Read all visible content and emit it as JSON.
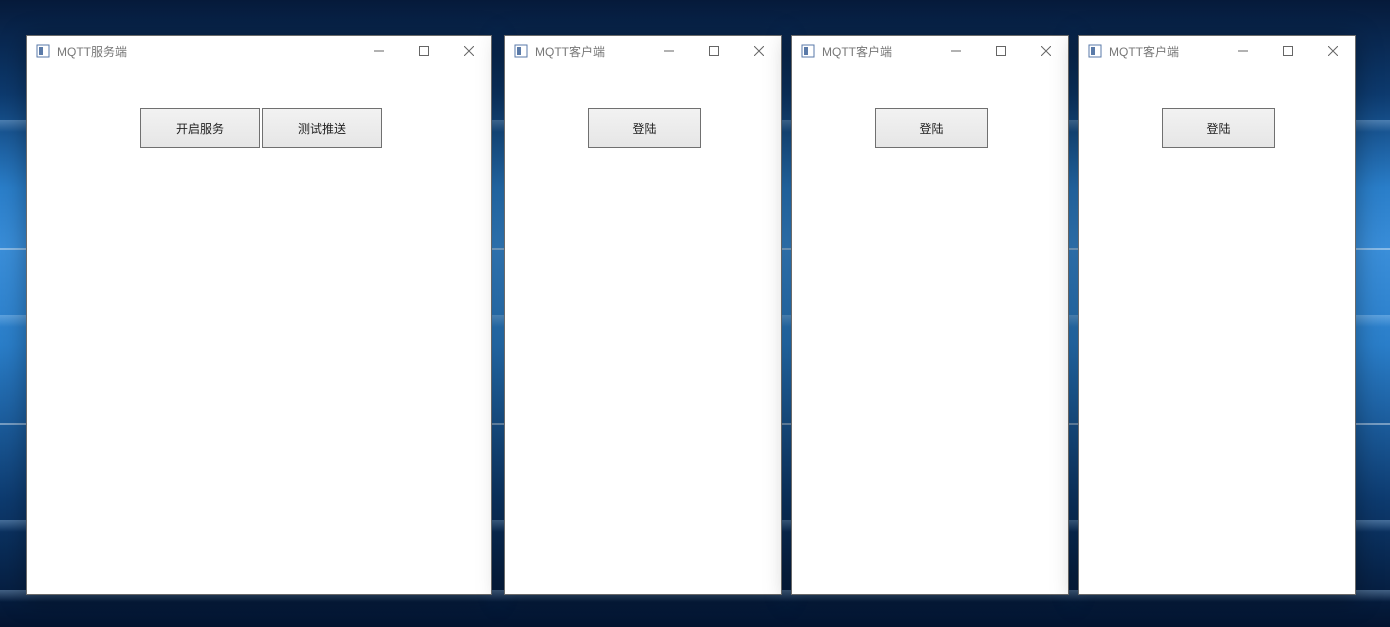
{
  "windows": {
    "server": {
      "title": "MQTT服务端",
      "buttons": {
        "start_service": "开启服务",
        "test_push": "测试推送"
      }
    },
    "client1": {
      "title": "MQTT客户端",
      "buttons": {
        "login": "登陆"
      }
    },
    "client2": {
      "title": "MQTT客户端",
      "buttons": {
        "login": "登陆"
      }
    },
    "client3": {
      "title": "MQTT客户端",
      "buttons": {
        "login": "登陆"
      }
    }
  },
  "window_controls": {
    "minimize": "minimize",
    "maximize": "maximize",
    "close": "close"
  }
}
